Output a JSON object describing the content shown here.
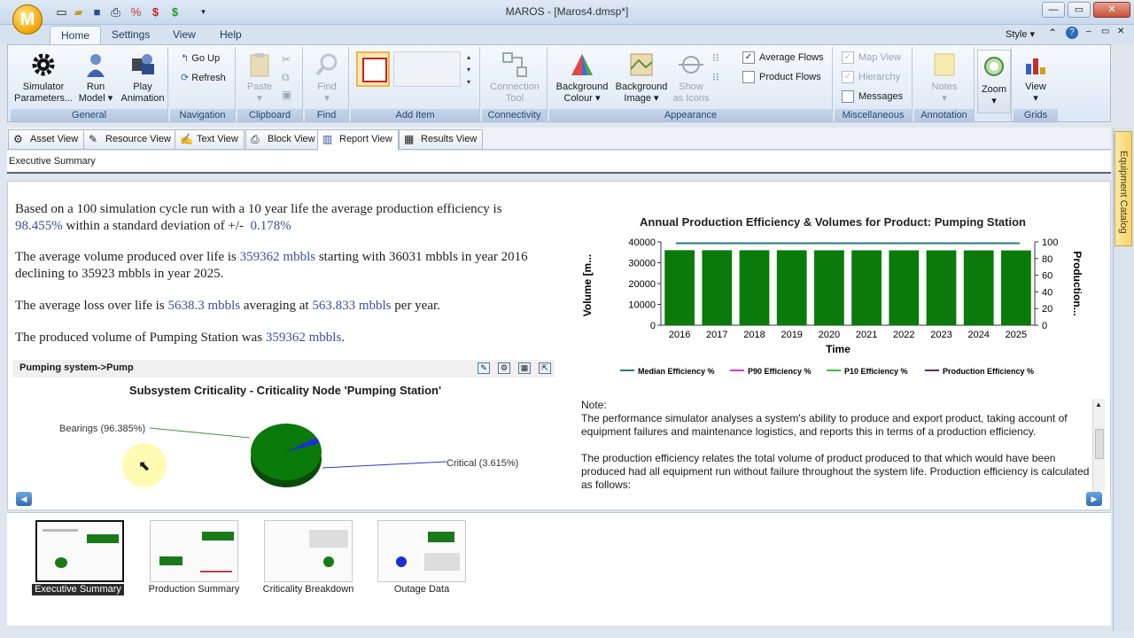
{
  "window": {
    "title": "MAROS - [Maros4.dmsp*]",
    "logo_letter": "M",
    "style_label": "Style"
  },
  "ribbon_tabs": [
    "Home",
    "Settings",
    "View",
    "Help"
  ],
  "groups": {
    "general": {
      "label": "General",
      "simulator": "Simulator",
      "simulator2": "Parameters...",
      "run": "Run",
      "run2": "Model",
      "play": "Play",
      "play2": "Animation"
    },
    "navigation": {
      "label": "Navigation",
      "goup": "Go Up",
      "refresh": "Refresh"
    },
    "clipboard": {
      "label": "Clipboard",
      "paste": "Paste"
    },
    "find": {
      "label": "Find",
      "find": "Find"
    },
    "additem": {
      "label": "Add Item"
    },
    "connectivity": {
      "label": "Connectivity",
      "conn": "Connection",
      "conn2": "Tool"
    },
    "appearance": {
      "label": "Appearance",
      "bgc": "Background",
      "bgc2": "Colour",
      "bgi": "Background",
      "bgi2": "Image",
      "show": "Show",
      "show2": "as Icons",
      "avgflows": "Average Flows",
      "prodflows": "Product Flows"
    },
    "misc": {
      "label": "Miscellaneous",
      "mapview": "Map View",
      "hierarchy": "Hierarchy",
      "messages": "Messages"
    },
    "annotation": {
      "label": "Annotation",
      "notes": "Notes"
    },
    "zoom": {
      "label": "Zoom"
    },
    "grids": {
      "label": "Grids",
      "view": "View"
    }
  },
  "view_tabs": [
    "Asset View",
    "Resource View",
    "Text View",
    "Block View",
    "Report View",
    "Results View"
  ],
  "breadcrumb": "Executive Summary",
  "summary": {
    "p1a": "Based on a 100 simulation cycle run with a 10 year life the average production efficiency is",
    "p1_eff": "98.455%",
    "p1b": " within a standard deviation of +/-",
    "p1_sd": "0.178%",
    "p2a": "The average volume produced over life is ",
    "p2_vol": "359362 mbbls",
    "p2b": " starting with 36031 mbbls in year 2016 declining to 35923 mbbls in year 2025.",
    "p3a": "The average loss over life is ",
    "p3_loss": "5638.3 mbbls",
    "p3b": " averaging at ",
    "p3_avg": "563.833 mbbls",
    "p3c": " per year.",
    "p4a": "The produced volume of Pumping Station was ",
    "p4_vol": "359362 mbbls",
    "p4b": "."
  },
  "pump_path": "Pumping system->Pump",
  "pie": {
    "title": "Subsystem Criticality - Criticality Node 'Pumping Station'",
    "slices": [
      {
        "label": "Bearings (96.385%)",
        "value": 96.385,
        "color": "#0a7a0a"
      },
      {
        "label": "Critical (3.615%)",
        "value": 3.615,
        "color": "#1a2fd6"
      }
    ]
  },
  "chart_data": {
    "type": "bar",
    "title": "Annual Production Efficiency & Volumes for Product: Pumping Station",
    "xlabel": "Time",
    "ylabel": "Volume [m...",
    "y2label": "Production...",
    "categories": [
      "2016",
      "2017",
      "2018",
      "2019",
      "2020",
      "2021",
      "2022",
      "2023",
      "2024",
      "2025"
    ],
    "values": [
      36031,
      36020,
      36010,
      36000,
      35990,
      35980,
      35965,
      35950,
      35935,
      35923
    ],
    "ylim": [
      0,
      40000
    ],
    "y_ticks": [
      "0",
      "10000",
      "20000",
      "30000",
      "40000"
    ],
    "y2lim": [
      0,
      100
    ],
    "y2_ticks": [
      "0",
      "20",
      "40",
      "60",
      "80",
      "100"
    ],
    "line_value": 98.455,
    "bar_color": "#0a7a0a",
    "legend": [
      "Median Efficiency %",
      "P90 Efficiency %",
      "P10 Efficiency %",
      "Production Efficiency %"
    ],
    "legend_colors": [
      "#2a7a7a",
      "#d23ad2",
      "#3cc13c",
      "#5a2a6a"
    ]
  },
  "note": {
    "heading": "Note:",
    "p1": "The performance simulator analyses a system's ability to produce and export product, taking account of equipment failures and maintenance logistics, and reports this in terms of a production efficiency.",
    "p2": "The production efficiency relates the total volume of product produced to that which would have been produced had all equipment run without failure throughout the system life.  Production efficiency is calculated as follows:"
  },
  "thumbnails": [
    "Executive Summary",
    "Production Summary",
    "Criticality Breakdown",
    "Outage Data"
  ],
  "side_panel": "Equipment Catalog"
}
